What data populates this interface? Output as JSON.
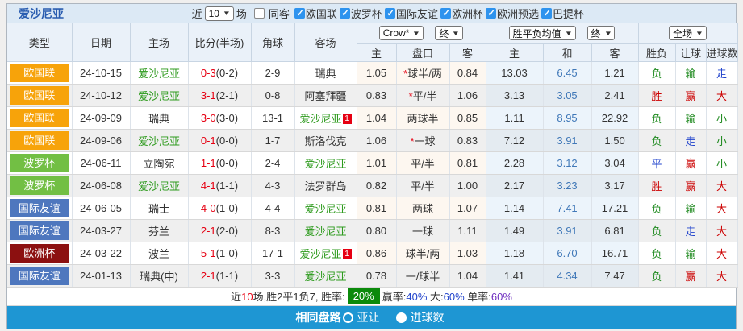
{
  "header": {
    "team": "爱沙尼亚",
    "recent_prefix": "近",
    "recent_count": "10",
    "recent_suffix": "场",
    "same_away_label": "同客",
    "same_away_checked": false,
    "filters": [
      "欧国联",
      "波罗杯",
      "国际友谊",
      "欧洲杯",
      "欧洲预选",
      "巴提杯"
    ]
  },
  "controls": {
    "odds_source": "Crow*",
    "odds_state": "终",
    "avg_label": "胜平负均值",
    "avg_state": "终",
    "scope": "全场"
  },
  "columns": {
    "main": [
      "类型",
      "日期",
      "主场",
      "比分(半场)",
      "角球",
      "客场"
    ],
    "sub": [
      "主",
      "盘口",
      "客",
      "主",
      "和",
      "客",
      "胜负",
      "让球",
      "进球数"
    ]
  },
  "league_colors": {
    "欧国联": "#F7A30A",
    "波罗杯": "#72BF44",
    "国际友谊": "#4E77BE",
    "欧洲杯": "#8C1010"
  },
  "result_colors": {
    "胜": "res-red",
    "平": "res-blue",
    "负": "res-green",
    "赢": "res-red",
    "走": "res-blue",
    "输": "res-green",
    "大": "res-red",
    "小": "res-green"
  },
  "rows": [
    {
      "league": "欧国联",
      "date": "24-10-15",
      "home": "爱沙尼亚",
      "home_green": true,
      "home_sup": "",
      "score": "0-3",
      "half": "(0-2)",
      "corner": "2-9",
      "away": "瑞典",
      "away_green": false,
      "away_sup": "",
      "odds_home": "1.05",
      "hcp_star": true,
      "handicap": "球半/两",
      "odds_away": "0.84",
      "avg_home": "13.03",
      "avg_draw": "6.45",
      "avg_away": "1.21",
      "result": "负",
      "handicap_result": "输",
      "goals_result": "走"
    },
    {
      "league": "欧国联",
      "date": "24-10-12",
      "home": "爱沙尼亚",
      "home_green": true,
      "home_sup": "",
      "score": "3-1",
      "half": "(2-1)",
      "corner": "0-8",
      "away": "阿塞拜疆",
      "away_green": false,
      "away_sup": "",
      "odds_home": "0.83",
      "hcp_star": true,
      "handicap": "平/半",
      "odds_away": "1.06",
      "avg_home": "3.13",
      "avg_draw": "3.05",
      "avg_away": "2.41",
      "result": "胜",
      "handicap_result": "赢",
      "goals_result": "大"
    },
    {
      "league": "欧国联",
      "date": "24-09-09",
      "home": "瑞典",
      "home_green": false,
      "home_sup": "",
      "score": "3-0",
      "half": "(3-0)",
      "corner": "13-1",
      "away": "爱沙尼亚",
      "away_green": true,
      "away_sup": "1",
      "odds_home": "1.04",
      "hcp_star": false,
      "handicap": "两球半",
      "odds_away": "0.85",
      "avg_home": "1.11",
      "avg_draw": "8.95",
      "avg_away": "22.92",
      "result": "负",
      "handicap_result": "输",
      "goals_result": "小"
    },
    {
      "league": "欧国联",
      "date": "24-09-06",
      "home": "爱沙尼亚",
      "home_green": true,
      "home_sup": "",
      "score": "0-1",
      "half": "(0-0)",
      "corner": "1-7",
      "away": "斯洛伐克",
      "away_green": false,
      "away_sup": "",
      "odds_home": "1.06",
      "hcp_star": true,
      "handicap": "一球",
      "odds_away": "0.83",
      "avg_home": "7.12",
      "avg_draw": "3.91",
      "avg_away": "1.50",
      "result": "负",
      "handicap_result": "走",
      "goals_result": "小"
    },
    {
      "league": "波罗杯",
      "date": "24-06-11",
      "home": "立陶宛",
      "home_green": false,
      "home_sup": "",
      "score": "1-1",
      "half": "(0-0)",
      "corner": "2-4",
      "away": "爱沙尼亚",
      "away_green": true,
      "away_sup": "",
      "odds_home": "1.01",
      "hcp_star": false,
      "handicap": "平/半",
      "odds_away": "0.81",
      "avg_home": "2.28",
      "avg_draw": "3.12",
      "avg_away": "3.04",
      "result": "平",
      "handicap_result": "赢",
      "goals_result": "小"
    },
    {
      "league": "波罗杯",
      "date": "24-06-08",
      "home": "爱沙尼亚",
      "home_green": true,
      "home_sup": "",
      "score": "4-1",
      "half": "(1-1)",
      "corner": "4-3",
      "away": "法罗群岛",
      "away_green": false,
      "away_sup": "",
      "odds_home": "0.82",
      "hcp_star": false,
      "handicap": "平/半",
      "odds_away": "1.00",
      "avg_home": "2.17",
      "avg_draw": "3.23",
      "avg_away": "3.17",
      "result": "胜",
      "handicap_result": "赢",
      "goals_result": "大"
    },
    {
      "league": "国际友谊",
      "date": "24-06-05",
      "home": "瑞士",
      "home_green": false,
      "home_sup": "",
      "score": "4-0",
      "half": "(1-0)",
      "corner": "4-4",
      "away": "爱沙尼亚",
      "away_green": true,
      "away_sup": "",
      "odds_home": "0.81",
      "hcp_star": false,
      "handicap": "两球",
      "odds_away": "1.07",
      "avg_home": "1.14",
      "avg_draw": "7.41",
      "avg_away": "17.21",
      "result": "负",
      "handicap_result": "输",
      "goals_result": "大"
    },
    {
      "league": "国际友谊",
      "date": "24-03-27",
      "home": "芬兰",
      "home_green": false,
      "home_sup": "",
      "score": "2-1",
      "half": "(2-0)",
      "corner": "8-3",
      "away": "爱沙尼亚",
      "away_green": true,
      "away_sup": "",
      "odds_home": "0.80",
      "hcp_star": false,
      "handicap": "一球",
      "odds_away": "1.11",
      "avg_home": "1.49",
      "avg_draw": "3.91",
      "avg_away": "6.81",
      "result": "负",
      "handicap_result": "走",
      "goals_result": "大"
    },
    {
      "league": "欧洲杯",
      "date": "24-03-22",
      "home": "波兰",
      "home_green": false,
      "home_sup": "",
      "score": "5-1",
      "half": "(1-0)",
      "corner": "17-1",
      "away": "爱沙尼亚",
      "away_green": true,
      "away_sup": "1",
      "odds_home": "0.86",
      "hcp_star": false,
      "handicap": "球半/两",
      "odds_away": "1.03",
      "avg_home": "1.18",
      "avg_draw": "6.70",
      "avg_away": "16.71",
      "result": "负",
      "handicap_result": "输",
      "goals_result": "大"
    },
    {
      "league": "国际友谊",
      "date": "24-01-13",
      "home": "瑞典(中)",
      "home_green": false,
      "home_sup": "",
      "score": "2-1",
      "half": "(1-1)",
      "corner": "3-3",
      "away": "爱沙尼亚",
      "away_green": true,
      "away_sup": "",
      "odds_home": "0.78",
      "hcp_star": false,
      "handicap": "一/球半",
      "odds_away": "1.04",
      "avg_home": "1.41",
      "avg_draw": "4.34",
      "avg_away": "7.47",
      "result": "负",
      "handicap_result": "赢",
      "goals_result": "大"
    }
  ],
  "summary": {
    "prefix": "近",
    "count": "10",
    "middle": "场,胜2平1负7, 胜率:",
    "rate_badge": "20%",
    "win_label": "赢率:",
    "win_value": "40%",
    "sep1": " 大:",
    "big_value": "60%",
    "sep2": " 单率:",
    "single_value": "60%"
  },
  "bottom_bar": {
    "title": "相同盘路",
    "option1": "亚让",
    "option2": "进球数",
    "selected": "进球数"
  }
}
